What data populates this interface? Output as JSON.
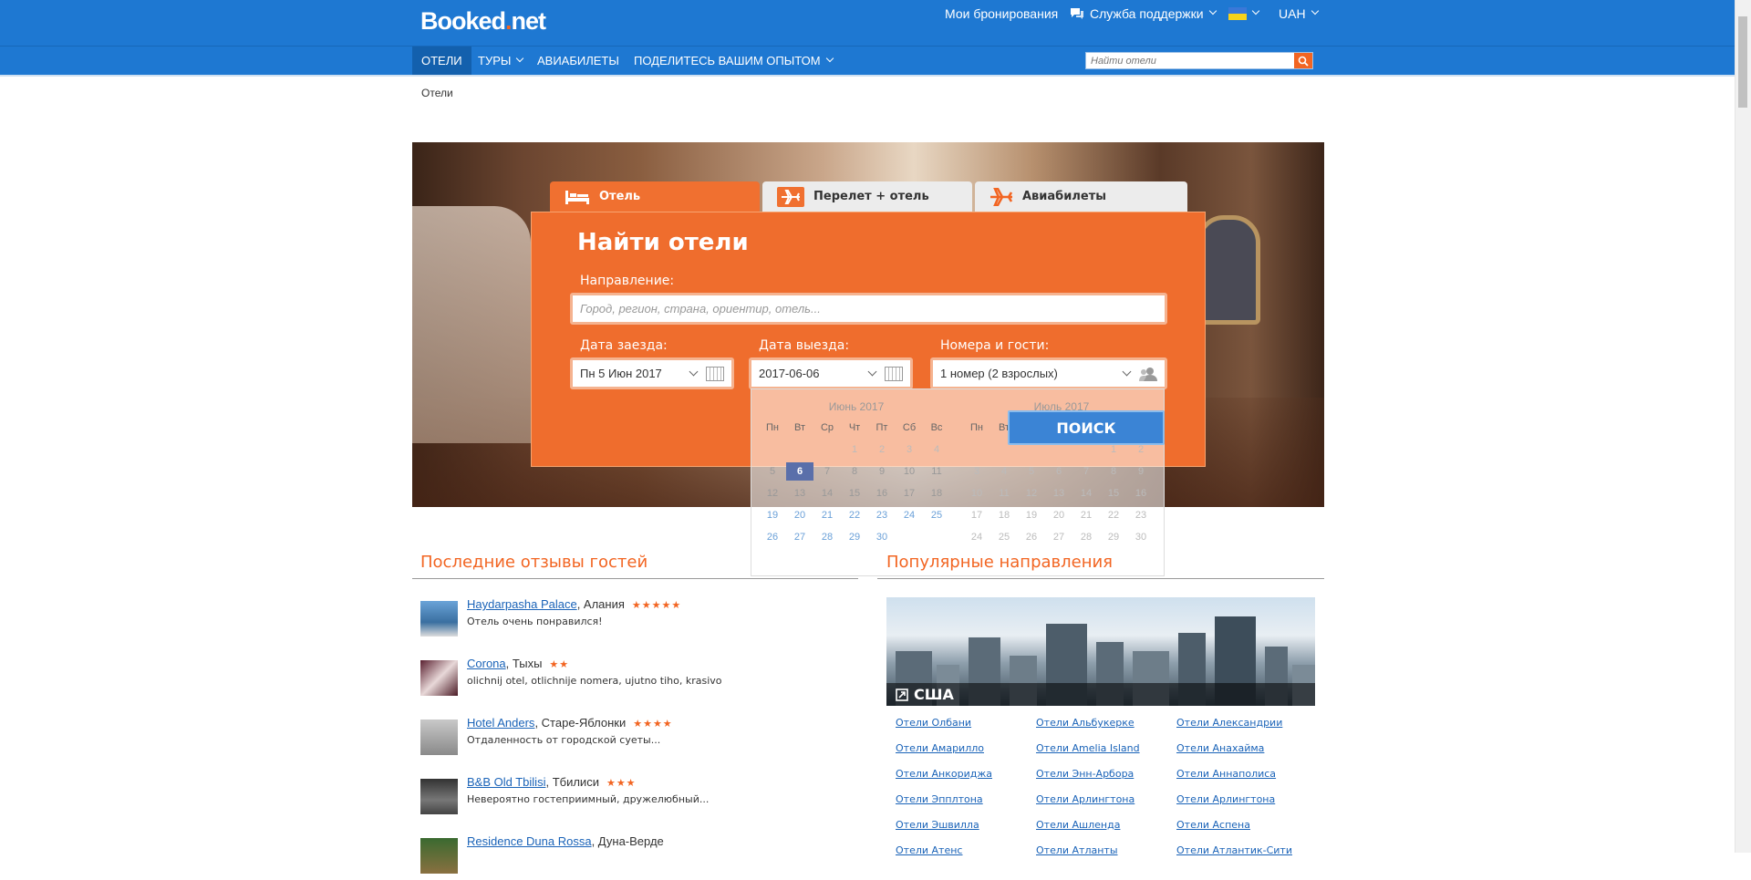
{
  "header": {
    "logo_main": "Booked",
    "logo_dot": ".",
    "logo_tld": "net",
    "my_bookings": "Мои бронирования",
    "support": "Служба поддержки",
    "currency": "UAH"
  },
  "nav": {
    "hotels": "ОТЕЛИ",
    "tours": "ТУРЫ",
    "flights": "АВИАБИЛЕТЫ",
    "share": "ПОДЕЛИТЕСЬ ВАШИМ ОПЫТОМ",
    "search_placeholder": "Найти отели"
  },
  "breadcrumb": "Отели",
  "tabs": {
    "hotel": "Отель",
    "flight_hotel": "Перелет + отель",
    "flights": "Авиабилеты"
  },
  "search_form": {
    "title": "Найти отели",
    "destination_label": "Направление:",
    "destination_placeholder": "Город, регион, страна, ориентир, отель...",
    "checkin_label": "Дата заезда:",
    "checkin_value": "Пн 5 Июн 2017",
    "checkout_label": "Дата выезда:",
    "checkout_value": "2017-06-06",
    "rooms_label": "Номера и гости:",
    "rooms_value": "1 номер (2 взрослых)",
    "search_button": "ПОИСК"
  },
  "calendar": {
    "month_left": "Июнь 2017",
    "month_right": "Июль 2017",
    "weekdays": [
      "Пн",
      "Вт",
      "Ср",
      "Чт",
      "Пт",
      "Сб",
      "Вс"
    ],
    "june_days": [
      "",
      "",
      "",
      "1",
      "2",
      "3",
      "4",
      "5",
      "6",
      "7",
      "8",
      "9",
      "10",
      "11",
      "12",
      "13",
      "14",
      "15",
      "16",
      "17",
      "18",
      "19",
      "20",
      "21",
      "22",
      "23",
      "24",
      "25",
      "26",
      "27",
      "28",
      "29",
      "30",
      "",
      ""
    ],
    "july_days": [
      "",
      "",
      "",
      "",
      "",
      "1",
      "2",
      "3",
      "4",
      "5",
      "6",
      "7",
      "8",
      "9",
      "10",
      "11",
      "12",
      "13",
      "14",
      "15",
      "16",
      "17",
      "18",
      "19",
      "20",
      "21",
      "22",
      "23",
      "24",
      "25",
      "26",
      "27",
      "28",
      "29",
      "30"
    ],
    "selected": "6"
  },
  "reviews_section": {
    "title": "Последние отзывы гостей",
    "items": [
      {
        "hotel": "Haydarpasha Palace",
        "city": ", Алания",
        "stars": "★★★★★",
        "text": "Отель очень понравился!"
      },
      {
        "hotel": "Corona",
        "city": ", Тыхы",
        "stars": "★★",
        "text": "olichnij otel, otlichnije nomera, ujutno tiho, krasivo"
      },
      {
        "hotel": "Hotel Anders",
        "city": ", Старе-Яблонки",
        "stars": "★★★★",
        "text": "Отдаленность от городской суеты..."
      },
      {
        "hotel": "B&B Old Tbilisi",
        "city": ", Тбилиси",
        "stars": "★★★",
        "text": "Невероятно гостеприимный, дружелюбный..."
      },
      {
        "hotel": "Residence Duna Rossa",
        "city": ", Дуна-Верде",
        "stars": "",
        "text": ""
      }
    ]
  },
  "popular_section": {
    "title": "Популярные направления",
    "country": "США",
    "cities": [
      "Отели Олбани",
      "Отели Альбукерке",
      "Отели Александрии",
      "Отели Амарилло",
      "Отели Amelia Island",
      "Отели Анахайма",
      "Отели Анкориджа",
      "Отели Энн-Арбора",
      "Отели Аннаполиса",
      "Отели Эпплтона",
      "Отели Арлингтона",
      "Отели Арлингтона",
      "Отели Эшвилла",
      "Отели Ашленда",
      "Отели Аспена",
      "Отели Атенс",
      "Отели Атланты",
      "Отели Атлантик-Сити"
    ]
  },
  "colors": {
    "brand_blue": "#1e78d2",
    "accent_orange": "#f26522",
    "panel_orange": "#ef6d2d"
  }
}
